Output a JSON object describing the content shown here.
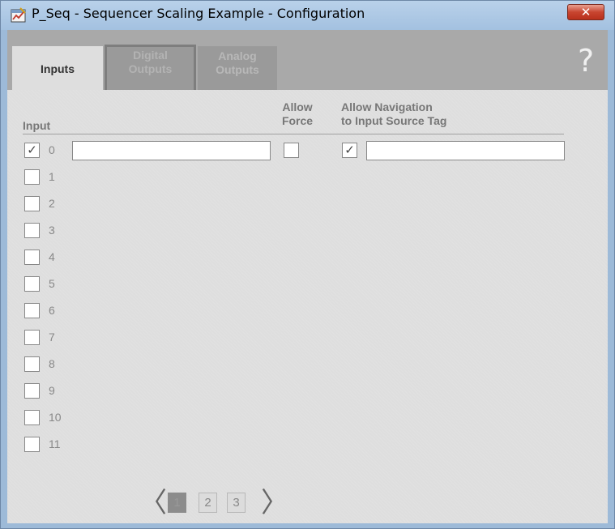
{
  "window": {
    "title": "P_Seq - Sequencer Scaling Example - Configuration",
    "close_glyph": "✕",
    "icon": "faceplate-app-icon"
  },
  "tabs": [
    {
      "label_line1": "Inputs",
      "label_line2": "",
      "state": "selected"
    },
    {
      "label_line1": "Digital",
      "label_line2": "Outputs",
      "state": "unselected"
    },
    {
      "label_line1": "Analog",
      "label_line2": "Outputs",
      "state": "unselected"
    }
  ],
  "help_glyph": "?",
  "headers": {
    "input": "Input",
    "allow_force_1": "Allow",
    "allow_force_2": "Force",
    "allow_nav_1": "Allow Navigation",
    "allow_nav_2": "to Input Source Tag"
  },
  "first_row": {
    "tag_value": "",
    "nav_source_value": ""
  },
  "rows": [
    {
      "num": "0",
      "checked": true,
      "mark": "✓"
    },
    {
      "num": "1",
      "checked": false,
      "mark": ""
    },
    {
      "num": "2",
      "checked": false,
      "mark": ""
    },
    {
      "num": "3",
      "checked": false,
      "mark": ""
    },
    {
      "num": "4",
      "checked": false,
      "mark": ""
    },
    {
      "num": "5",
      "checked": false,
      "mark": ""
    },
    {
      "num": "6",
      "checked": false,
      "mark": ""
    },
    {
      "num": "7",
      "checked": false,
      "mark": ""
    },
    {
      "num": "8",
      "checked": false,
      "mark": ""
    },
    {
      "num": "9",
      "checked": false,
      "mark": ""
    },
    {
      "num": "10",
      "checked": false,
      "mark": ""
    },
    {
      "num": "11",
      "checked": false,
      "mark": ""
    }
  ],
  "allow_force_checked": false,
  "allow_nav_mark": "✓",
  "pager": {
    "prev": "〈",
    "next": "〉",
    "pages": [
      "1",
      "2",
      "3"
    ],
    "current": "1"
  },
  "colors": {
    "panel_bg": "#dedede",
    "tab_strip": "#a9a9a9",
    "close_button": "#c84530",
    "current_page": "#8c8c8c"
  }
}
